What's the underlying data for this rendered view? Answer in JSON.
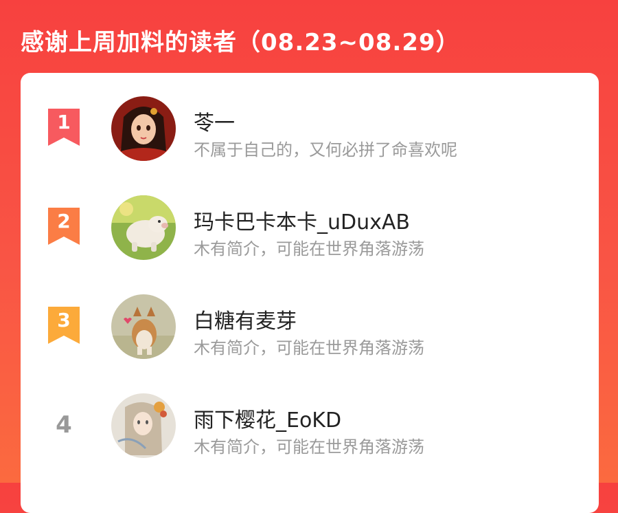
{
  "header": {
    "title": "感谢上周加料的读者（08.23~08.29）"
  },
  "colors": {
    "background_top": "#f7413f",
    "background_bottom": "#fb6a3f",
    "rank1": "#f75a5f",
    "rank2": "#fb7d45",
    "rank3": "#fcaa3a",
    "rank_plain": "#999999",
    "name_text": "#222222",
    "bio_text": "#9a9a9a"
  },
  "readers": [
    {
      "rank": "1",
      "name": "苓一",
      "bio": "不属于自己的，又何必拼了命喜欢呢",
      "avatar": "anime-girl-avatar"
    },
    {
      "rank": "2",
      "name": "玛卡巴卡本卡_uDuxAB",
      "bio": "木有简介，可能在世界角落游荡",
      "avatar": "toy-pig-avatar"
    },
    {
      "rank": "3",
      "name": "白糖有麦芽",
      "bio": "木有简介，可能在世界角落游荡",
      "avatar": "corgi-avatar"
    },
    {
      "rank": "4",
      "name": "雨下樱花_EoKD",
      "bio": "木有简介，可能在世界角落游荡",
      "avatar": "illustrated-girl-avatar"
    }
  ]
}
